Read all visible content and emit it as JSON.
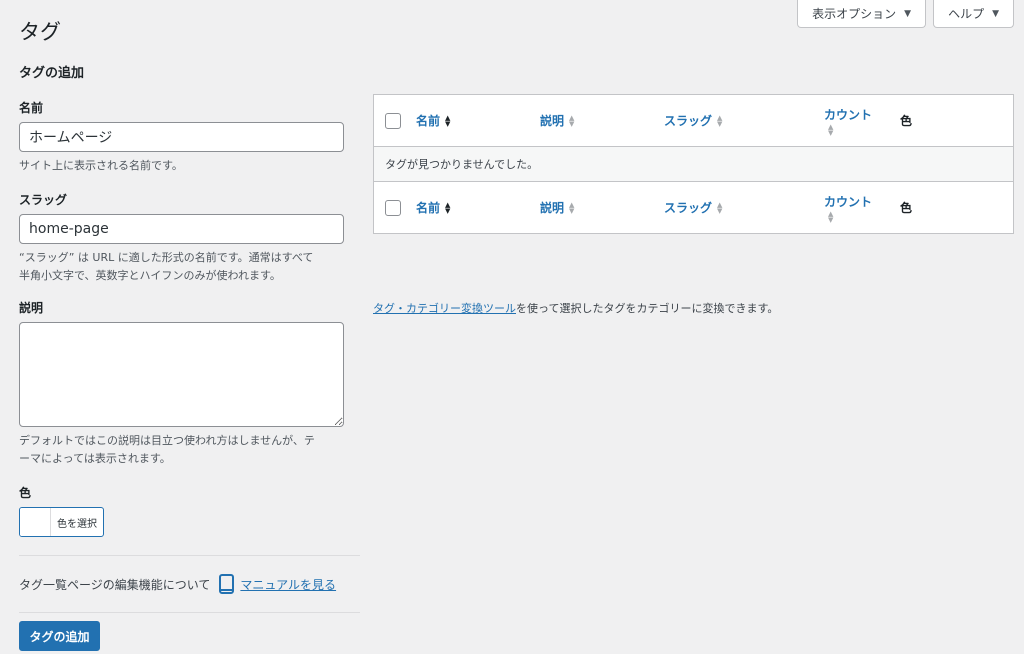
{
  "header": {
    "screen_options_label": "表示オプション",
    "help_label": "ヘルプ",
    "page_title": "タグ"
  },
  "form": {
    "heading": "タグの追加",
    "name_label": "名前",
    "name_value": "ホームページ",
    "name_help": "サイト上に表示される名前です。",
    "slug_label": "スラッグ",
    "slug_value": "home-page",
    "slug_help_1": "“スラッグ” は URL に適した形式の名前です。通常はすべて",
    "slug_help_2": "半角小文字で、英数字とハイフンのみが使われます。",
    "desc_label": "説明",
    "desc_help_1": "デフォルトではこの説明は目立つ使われ方はしませんが、テ",
    "desc_help_2": "ーマによっては表示されます。",
    "color_label": "色",
    "color_button_label": "色を選択",
    "manual_text": "タグ一覧ページの編集機能について",
    "manual_link": "マニュアルを見る",
    "submit_label": "タグの追加"
  },
  "table": {
    "columns": {
      "name": "名前",
      "description": "説明",
      "slug": "スラッグ",
      "count": "カウント",
      "color": "色"
    },
    "empty_message": "タグが見つかりませんでした。"
  },
  "convert": {
    "link": "タグ・カテゴリー変換ツール",
    "text": "を使って選択したタグをカテゴリーに変換できます。"
  },
  "colors": {
    "accent": "#2271b1",
    "background": "#f0f0f1"
  }
}
